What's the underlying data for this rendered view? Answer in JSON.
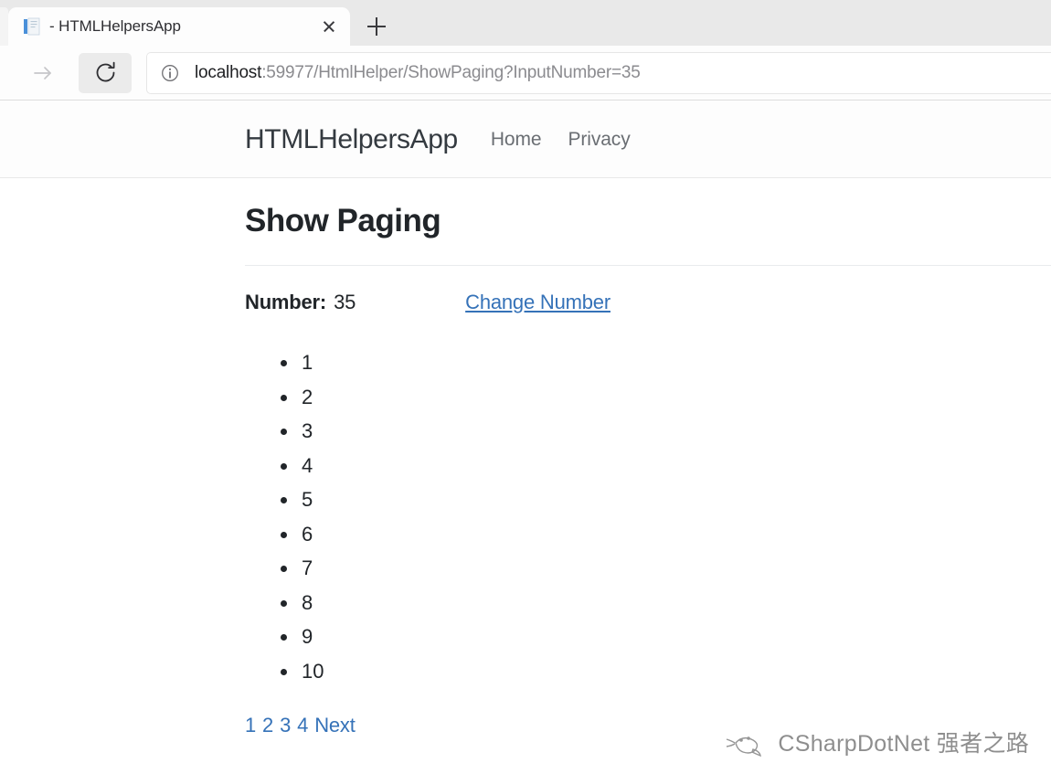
{
  "browser": {
    "tab": {
      "title": "- HTMLHelpersApp",
      "favicon_name": "document-favicon",
      "close_label": "Close tab"
    },
    "new_tab_label": "New tab",
    "toolbar": {
      "forward_label": "Forward",
      "reload_label": "Refresh",
      "site_info_label": "View site information",
      "url_host": "localhost",
      "url_rest": ":59977/HtmlHelper/ShowPaging?InputNumber=35"
    }
  },
  "site": {
    "brand": "HTMLHelpersApp",
    "nav": [
      {
        "label": "Home"
      },
      {
        "label": "Privacy"
      }
    ]
  },
  "main": {
    "title": "Show Paging",
    "number_label": "Number:",
    "number_value": "35",
    "change_link": "Change Number",
    "items": [
      "1",
      "2",
      "3",
      "4",
      "5",
      "6",
      "7",
      "8",
      "9",
      "10"
    ],
    "pagination": [
      "1",
      "2",
      "3",
      "4",
      "Next"
    ]
  },
  "watermark": {
    "text": "CSharpDotNet 强者之路",
    "icon_name": "wechat-mascot-icon"
  },
  "colors": {
    "link": "#3572b8",
    "text": "#212529",
    "muted": "#6a6e73",
    "tabstrip": "#e9e9e9"
  }
}
